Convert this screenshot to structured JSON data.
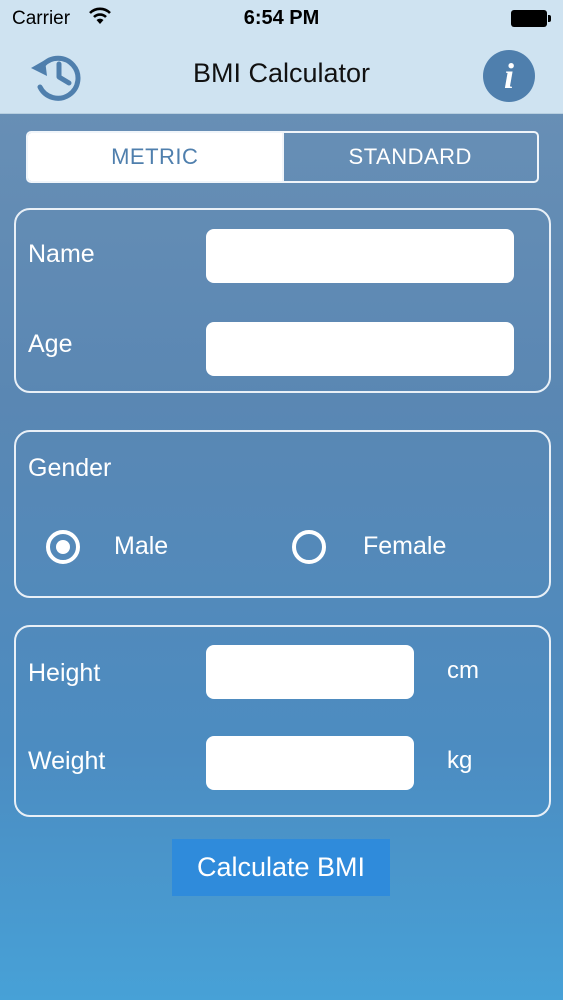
{
  "status_bar": {
    "carrier": "Carrier",
    "time": "6:54 PM"
  },
  "nav": {
    "title": "BMI Calculator",
    "left_icon": "history-icon",
    "right_icon": "info-icon",
    "info_glyph": "i"
  },
  "unit_toggle": {
    "options": [
      "METRIC",
      "STANDARD"
    ],
    "selected": "METRIC"
  },
  "personal": {
    "name_label": "Name",
    "name_value": "",
    "age_label": "Age",
    "age_value": ""
  },
  "gender": {
    "label": "Gender",
    "options": [
      "Male",
      "Female"
    ],
    "selected": "Male"
  },
  "measurements": {
    "height_label": "Height",
    "height_value": "",
    "height_unit": "cm",
    "weight_label": "Weight",
    "weight_value": "",
    "weight_unit": "kg"
  },
  "calculate_label": "Calculate BMI",
  "colors": {
    "accent": "#4f7fad",
    "button": "#2f8bdb",
    "bar": "#cfe3f1"
  }
}
